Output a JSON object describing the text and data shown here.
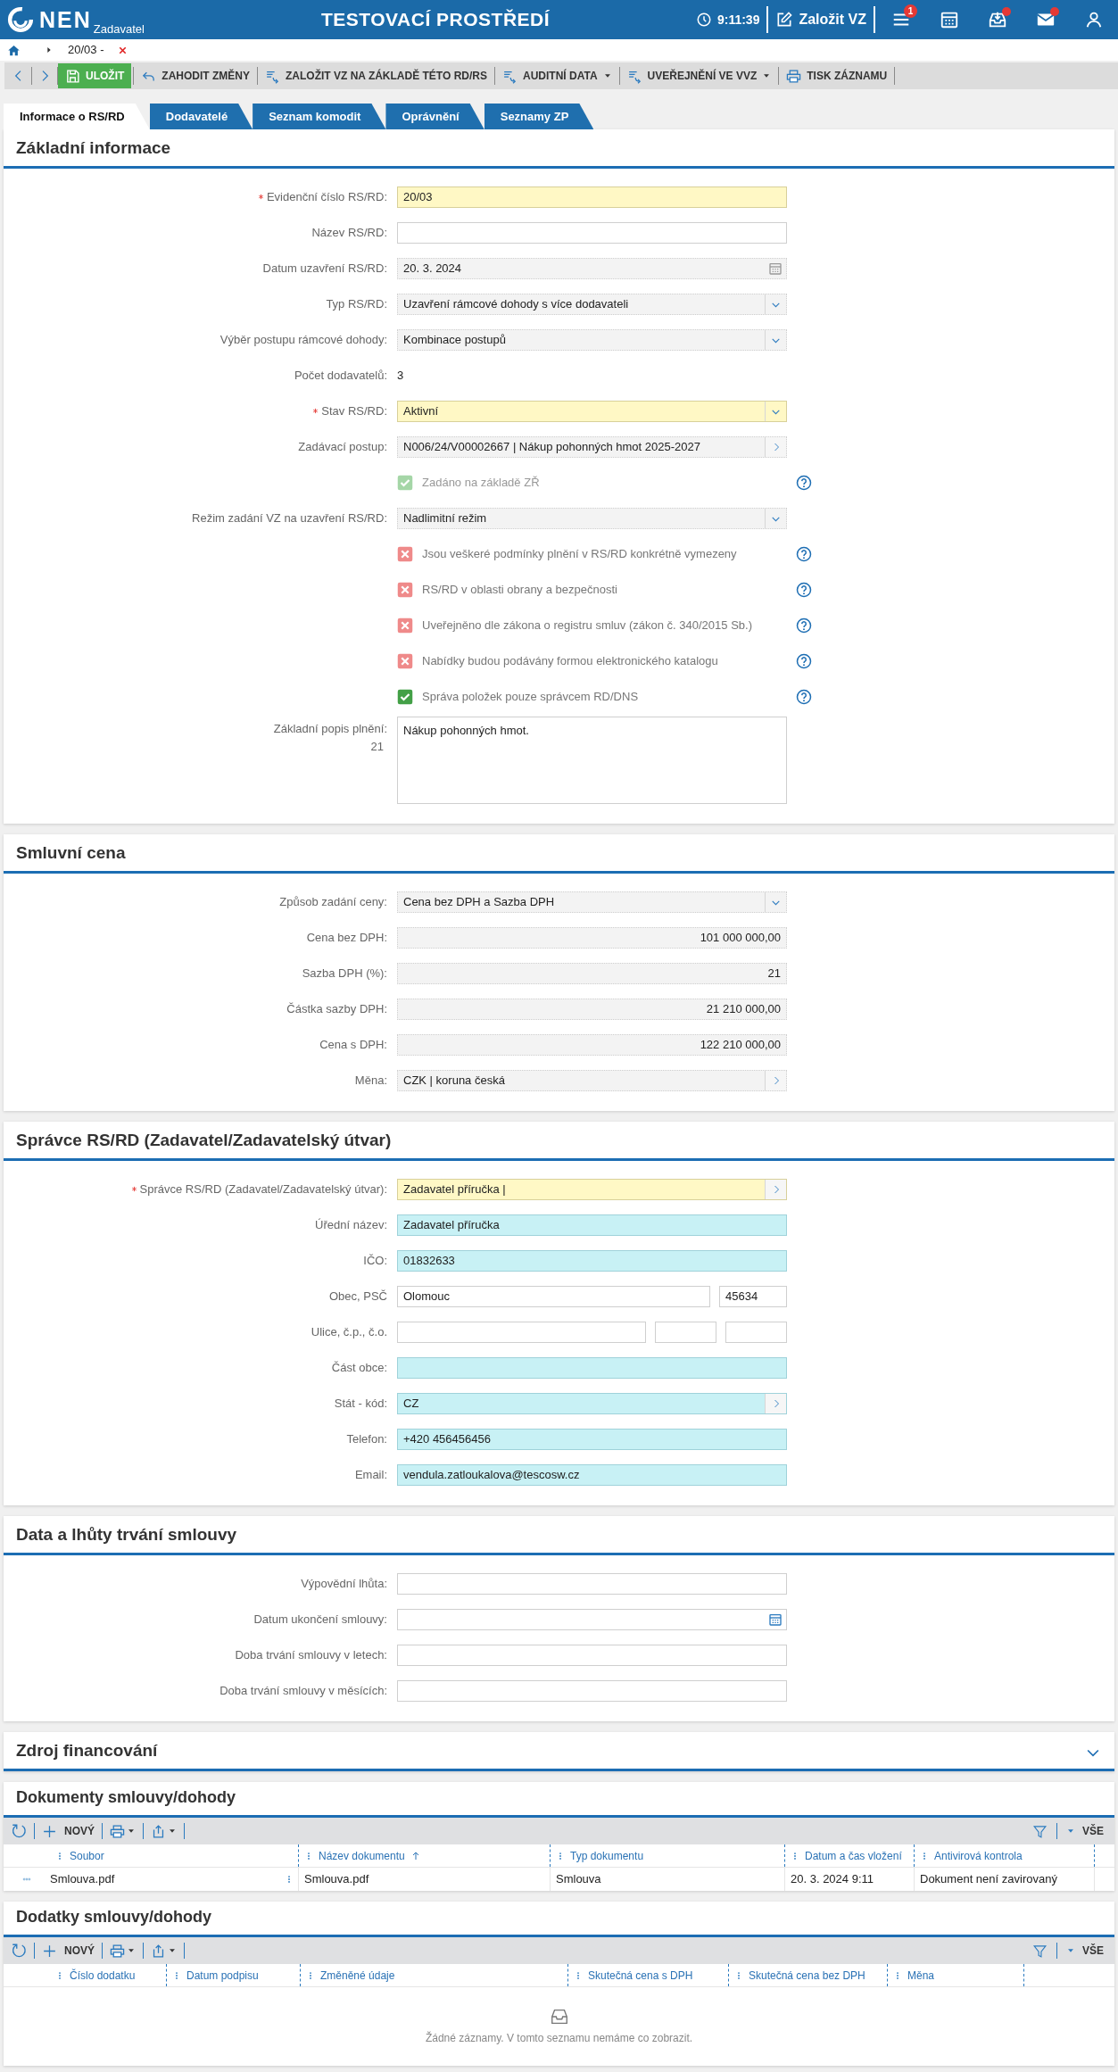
{
  "header": {
    "logo_text": "NEN",
    "logo_subtitle": "Zadavatel",
    "title": "TESTOVACÍ PROSTŘEDÍ",
    "time": "9:11:39",
    "create_button": "Založit VZ",
    "icons": [
      {
        "kind": "menu",
        "badge": "1",
        "dot": false
      },
      {
        "kind": "calendar",
        "dot": false
      },
      {
        "kind": "inbox",
        "dot": true
      },
      {
        "kind": "mail",
        "dot": true
      },
      {
        "kind": "user",
        "dot": false
      }
    ]
  },
  "breadcrumb": {
    "label": "20/03 -"
  },
  "toolbar": [
    {
      "kind": "save",
      "label": "ULOŽIT",
      "dropdown": false
    },
    {
      "kind": "undo",
      "label": "ZAHODIT ZMĚNY",
      "dropdown": false
    },
    {
      "kind": "doc",
      "label": "ZALOŽIT VZ NA ZÁKLADĚ TÉTO RD/RS",
      "dropdown": false
    },
    {
      "kind": "doc",
      "label": "AUDITNÍ DATA",
      "dropdown": true
    },
    {
      "kind": "doc",
      "label": "UVEŘEJNĚNÍ VE VVZ",
      "dropdown": true
    },
    {
      "kind": "print",
      "label": "TISK ZÁZNAMU",
      "dropdown": false
    }
  ],
  "tabs": [
    {
      "label": "Informace o RS/RD",
      "selected": true
    },
    {
      "label": "Dodavatelé",
      "selected": false
    },
    {
      "label": "Seznam komodit",
      "selected": false
    },
    {
      "label": "Oprávnění",
      "selected": false
    },
    {
      "label": "Seznamy ZP",
      "selected": false
    }
  ],
  "sections": [
    {
      "title": "Základní informace",
      "fields": [
        {
          "kind": "text",
          "label": "Evidenční číslo RS/RD:",
          "required": true,
          "readonly": false,
          "prefilled": false,
          "value": "20/03"
        },
        {
          "kind": "text",
          "label": "Název RS/RD:",
          "required": false,
          "readonly": false,
          "prefilled": false
        },
        {
          "kind": "date",
          "label": "Datum uzavření RS/RD:",
          "required": false,
          "readonly": true,
          "prefilled": false,
          "value": "20. 3. 2024"
        },
        {
          "kind": "select",
          "label": "Typ RS/RD:",
          "required": false,
          "readonly": true,
          "prefilled": false,
          "value": "Uzavření rámcové dohody s více dodavateli"
        },
        {
          "kind": "select",
          "label": "Výběr postupu rámcové dohody:",
          "required": false,
          "readonly": true,
          "prefilled": false,
          "value": "Kombinace postupů"
        },
        {
          "kind": "static",
          "label": "Počet dodavatelů:",
          "value": "3"
        },
        {
          "kind": "select",
          "label": "Stav RS/RD:",
          "required": true,
          "readonly": false,
          "prefilled": false,
          "value": "Aktivní"
        },
        {
          "kind": "lookup",
          "label": "Zadávací postup:",
          "required": false,
          "readonly": true,
          "prefilled": false,
          "value": "N006/24/V00002667 | Nákup pohonných hmot 2025-2027"
        },
        {
          "kind": "checkbox",
          "label": "Zadáno na základě ZŘ",
          "checked": true,
          "disabled": true,
          "help": true
        },
        {
          "kind": "select",
          "label": "Režim zadání VZ na uzavření RS/RD:",
          "required": false,
          "readonly": true,
          "prefilled": false,
          "value": "Nadlimitní režim"
        },
        {
          "kind": "checkbox",
          "label": "Jsou veškeré podmínky plnění v RS/RD konkrétně vymezeny",
          "checked": false,
          "disabled": false,
          "help": true
        },
        {
          "kind": "checkbox",
          "label": "RS/RD v oblasti obrany a bezpečnosti",
          "checked": false,
          "disabled": false,
          "help": true
        },
        {
          "kind": "checkbox",
          "label": "Uveřejněno dle zákona o registru smluv (zákon č. 340/2015 Sb.)",
          "checked": false,
          "disabled": false,
          "help": true
        },
        {
          "kind": "checkbox",
          "label": "Nabídky budou podávány formou elektronického katalogu",
          "checked": false,
          "disabled": false,
          "help": true
        },
        {
          "kind": "checkbox",
          "label": "Správa položek pouze správcem RD/DNS",
          "checked": true,
          "disabled": false,
          "help": true
        },
        {
          "kind": "textarea",
          "label": "Základní popis plnění:",
          "counter": "21",
          "required": false,
          "readonly": false,
          "prefilled": false,
          "value": "Nákup pohonných hmot."
        }
      ]
    },
    {
      "title": "Smluvní cena",
      "fields": [
        {
          "kind": "select",
          "label": "Způsob zadání ceny:",
          "required": false,
          "readonly": true,
          "prefilled": false,
          "value": "Cena bez DPH a Sazba DPH"
        },
        {
          "kind": "text",
          "label": "Cena bez DPH:",
          "required": false,
          "readonly": true,
          "prefilled": false,
          "align_right": true,
          "value": "101 000 000,00"
        },
        {
          "kind": "text",
          "label": "Sazba DPH (%):",
          "required": false,
          "readonly": true,
          "prefilled": false,
          "align_right": true,
          "value": "21"
        },
        {
          "kind": "text",
          "label": "Částka sazby DPH:",
          "required": false,
          "readonly": true,
          "prefilled": false,
          "align_right": true,
          "value": "21 210 000,00"
        },
        {
          "kind": "text",
          "label": "Cena s DPH:",
          "required": false,
          "readonly": true,
          "prefilled": false,
          "align_right": true,
          "value": "122 210 000,00"
        },
        {
          "kind": "lookup",
          "label": "Měna:",
          "required": false,
          "readonly": true,
          "prefilled": false,
          "value": "CZK | koruna česká"
        }
      ]
    },
    {
      "title": "Správce RS/RD (Zadavatel/Zadavatelský útvar)",
      "fields": [
        {
          "kind": "lookup",
          "label": "Správce RS/RD (Zadavatel/Zadavatelský útvar):",
          "required": true,
          "readonly": false,
          "prefilled": false,
          "value": "Zadavatel příručka |"
        },
        {
          "kind": "text",
          "label": "Úřední název:",
          "required": false,
          "readonly": false,
          "prefilled": true,
          "value": "Zadavatel příručka"
        },
        {
          "kind": "text",
          "label": "IČO:",
          "required": false,
          "readonly": false,
          "prefilled": true,
          "value": "01832633"
        },
        {
          "kind": "split",
          "label": "Obec, PSČ",
          "required": false,
          "parts": [
            {
              "readonly": false,
              "prefilled": false,
              "value": "Olomouc"
            },
            {
              "readonly": false,
              "prefilled": false,
              "value": "45634"
            }
          ]
        },
        {
          "kind": "split",
          "label": "Ulice, č.p., č.o.",
          "required": false,
          "parts": [
            {
              "readonly": false,
              "prefilled": false
            },
            {
              "readonly": false,
              "prefilled": false
            },
            {
              "readonly": false,
              "prefilled": false
            }
          ]
        },
        {
          "kind": "text",
          "label": "Část obce:",
          "required": false,
          "readonly": false,
          "prefilled": true
        },
        {
          "kind": "lookup",
          "label": "Stát - kód:",
          "required": false,
          "readonly": false,
          "prefilled": true,
          "value": "CZ"
        },
        {
          "kind": "text",
          "label": "Telefon:",
          "required": false,
          "readonly": false,
          "prefilled": true,
          "value": "+420 456456456"
        },
        {
          "kind": "text",
          "label": "Email:",
          "required": false,
          "readonly": false,
          "prefilled": true,
          "value": "vendula.zatloukalova@tescosw.cz"
        }
      ]
    },
    {
      "title": "Data a lhůty trvání smlouvy",
      "fields": [
        {
          "kind": "text",
          "label": "Výpovědní lhůta:",
          "required": false,
          "readonly": false,
          "prefilled": false
        },
        {
          "kind": "date",
          "label": "Datum ukončení smlouvy:",
          "required": false,
          "readonly": false,
          "prefilled": false
        },
        {
          "kind": "text",
          "label": "Doba trvání smlouvy v letech:",
          "required": false,
          "readonly": false,
          "prefilled": false
        },
        {
          "kind": "text",
          "label": "Doba trvání smlouvy v měsících:",
          "required": false,
          "readonly": false,
          "prefilled": false
        }
      ]
    },
    {
      "title": "Zdroj financování",
      "expanded": false
    }
  ],
  "tables": [
    {
      "title": "Dokumenty smlouvy/dohody",
      "new_label": "NOVÝ",
      "filter_label": "VŠE",
      "columns": [
        {
          "label": "Soubor",
          "sorted": false
        },
        {
          "label": "Název dokumentu",
          "sorted": true
        },
        {
          "label": "Typ dokumentu",
          "sorted": false
        },
        {
          "label": "Datum a čas vložení",
          "sorted": false
        },
        {
          "label": "Antivirová kontrola",
          "sorted": false
        }
      ],
      "rows": [
        [
          "Smlouva.pdf",
          "Smlouva.pdf",
          "Smlouva",
          "20. 3. 2024 9:11",
          "Dokument není zavirovaný"
        ]
      ]
    },
    {
      "title": "Dodatky smlouvy/dohody",
      "new_label": "NOVÝ",
      "filter_label": "VŠE",
      "columns": [
        {
          "label": "Číslo dodatku",
          "sorted": false
        },
        {
          "label": "Datum podpisu",
          "sorted": false
        },
        {
          "label": "Změněné údaje",
          "sorted": false
        },
        {
          "label": "Skutečná cena s DPH",
          "sorted": false
        },
        {
          "label": "Skutečná cena bez DPH",
          "sorted": false
        },
        {
          "label": "Měna",
          "sorted": false
        }
      ],
      "empty_message": "Žádné záznamy. V tomto seznamu nemáme co zobrazit."
    }
  ]
}
